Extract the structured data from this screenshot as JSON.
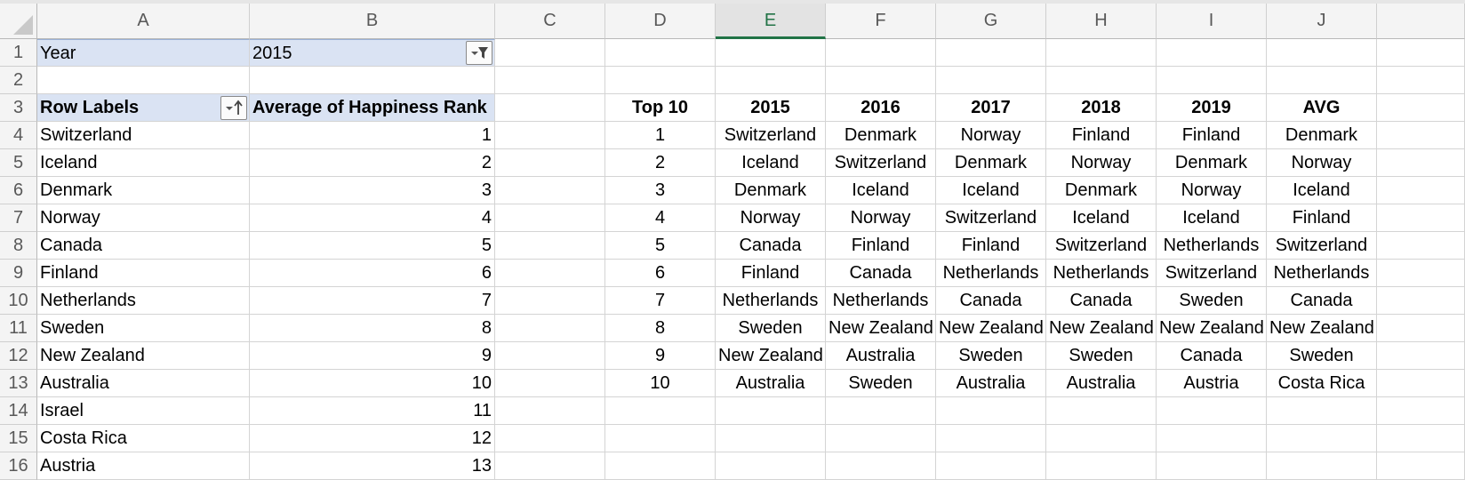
{
  "columns": [
    "A",
    "B",
    "C",
    "D",
    "E",
    "F",
    "G",
    "H",
    "I",
    "J"
  ],
  "active_column": "E",
  "rows": [
    "1",
    "2",
    "3",
    "4",
    "5",
    "6",
    "7",
    "8",
    "9",
    "10",
    "11",
    "12",
    "13",
    "14",
    "15",
    "16"
  ],
  "pivot": {
    "filter_label": "Year",
    "filter_value": "2015",
    "row_labels_header": "Row Labels",
    "value_header": "Average of Happiness Rank",
    "rows": [
      {
        "label": "Switzerland",
        "value": "1"
      },
      {
        "label": "Iceland",
        "value": "2"
      },
      {
        "label": "Denmark",
        "value": "3"
      },
      {
        "label": "Norway",
        "value": "4"
      },
      {
        "label": "Canada",
        "value": "5"
      },
      {
        "label": "Finland",
        "value": "6"
      },
      {
        "label": "Netherlands",
        "value": "7"
      },
      {
        "label": "Sweden",
        "value": "8"
      },
      {
        "label": "New Zealand",
        "value": "9"
      },
      {
        "label": "Australia",
        "value": "10"
      },
      {
        "label": "Israel",
        "value": "11"
      },
      {
        "label": "Costa Rica",
        "value": "12"
      },
      {
        "label": "Austria",
        "value": "13"
      }
    ]
  },
  "top10": {
    "headers": [
      "Top 10",
      "2015",
      "2016",
      "2017",
      "2018",
      "2019",
      "AVG"
    ],
    "rows": [
      [
        "1",
        "Switzerland",
        "Denmark",
        "Norway",
        "Finland",
        "Finland",
        "Denmark"
      ],
      [
        "2",
        "Iceland",
        "Switzerland",
        "Denmark",
        "Norway",
        "Denmark",
        "Norway"
      ],
      [
        "3",
        "Denmark",
        "Iceland",
        "Iceland",
        "Denmark",
        "Norway",
        "Iceland"
      ],
      [
        "4",
        "Norway",
        "Norway",
        "Switzerland",
        "Iceland",
        "Iceland",
        "Finland"
      ],
      [
        "5",
        "Canada",
        "Finland",
        "Finland",
        "Switzerland",
        "Netherlands",
        "Switzerland"
      ],
      [
        "6",
        "Finland",
        "Canada",
        "Netherlands",
        "Netherlands",
        "Switzerland",
        "Netherlands"
      ],
      [
        "7",
        "Netherlands",
        "Netherlands",
        "Canada",
        "Canada",
        "Sweden",
        "Canada"
      ],
      [
        "8",
        "Sweden",
        "New Zealand",
        "New Zealand",
        "New Zealand",
        "New Zealand",
        "New Zealand"
      ],
      [
        "9",
        "New Zealand",
        "Australia",
        "Sweden",
        "Sweden",
        "Canada",
        "Sweden"
      ],
      [
        "10",
        "Australia",
        "Sweden",
        "Australia",
        "Australia",
        "Austria",
        "Costa Rica"
      ]
    ]
  },
  "icons": {
    "filter_dropdown": "filter-dropdown-icon",
    "sort_dropdown": "sort-ascending-dropdown-icon"
  },
  "colors": {
    "pivot_header_fill": "#dae3f3",
    "active_column_accent": "#217346",
    "gridline": "#d4d4d4"
  }
}
